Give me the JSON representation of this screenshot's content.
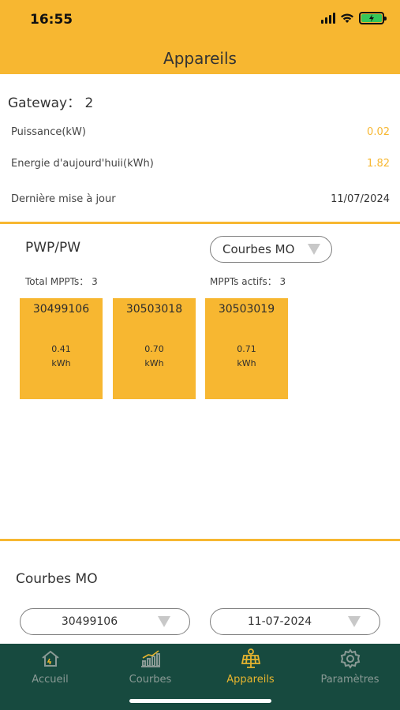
{
  "status_bar": {
    "time": "16:55"
  },
  "header": {
    "title": "Appareils"
  },
  "gateway": {
    "title": "Gateway： 2",
    "rows": [
      {
        "label": "Puissance(kW)",
        "value": "0.02"
      },
      {
        "label": "Energie d'aujourd'huii(kWh)",
        "value": "1.82"
      },
      {
        "label": "Dernière mise à jour",
        "value": "11/07/2024"
      }
    ]
  },
  "pwp": {
    "title": "PWP/PW",
    "dropdown": "Courbes MO",
    "total_mppts": "Total MPPTs： 3",
    "active_mppts": "MPPTs actifs： 3",
    "cards": [
      {
        "id": "30499106",
        "value": "0.41",
        "unit": "kWh"
      },
      {
        "id": "30503018",
        "value": "0.70",
        "unit": "kWh"
      },
      {
        "id": "30503019",
        "value": "0.71",
        "unit": "kWh"
      }
    ]
  },
  "courbes": {
    "title": "Courbes MO",
    "device_select": "30499106",
    "date_select": "11-07-2024"
  },
  "tabbar": {
    "tabs": [
      {
        "label": "Accueil",
        "icon": "home-icon",
        "active": false
      },
      {
        "label": "Courbes",
        "icon": "chart-icon",
        "active": false
      },
      {
        "label": "Appareils",
        "icon": "solar-panel-icon",
        "active": true
      },
      {
        "label": "Paramètres",
        "icon": "gear-icon",
        "active": false
      }
    ]
  },
  "colors": {
    "accent": "#f7b731",
    "tabbar_bg": "#174a3f",
    "tab_active": "#e8b52e",
    "tab_inactive": "#8a9a95"
  }
}
